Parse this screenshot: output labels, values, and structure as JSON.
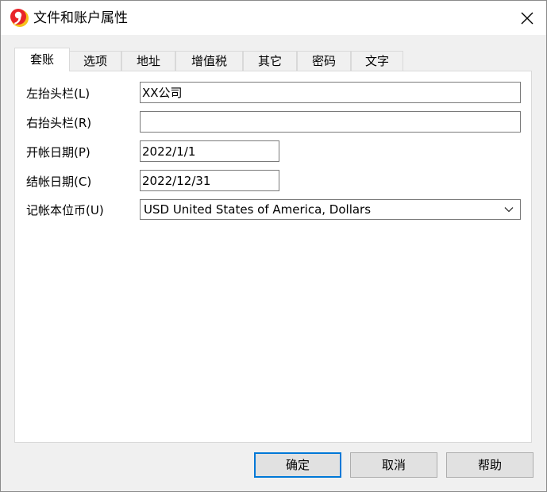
{
  "window": {
    "title": "文件和账户属性"
  },
  "tabs": [
    {
      "label": "套账",
      "active": true
    },
    {
      "label": "选项"
    },
    {
      "label": "地址"
    },
    {
      "label": "增值税"
    },
    {
      "label": "其它"
    },
    {
      "label": "密码"
    },
    {
      "label": "文字"
    }
  ],
  "form": {
    "left_header_label": "左抬头栏(L)",
    "left_header_value": "XX公司",
    "right_header_label": "右抬头栏(R)",
    "right_header_value": "",
    "open_date_label": "开帐日期(P)",
    "open_date_value": "2022/1/1",
    "close_date_label": "结帐日期(C)",
    "close_date_value": "2022/12/31",
    "currency_label": "记帐本位币(U)",
    "currency_value": "USD United States of America, Dollars"
  },
  "buttons": {
    "ok": "确定",
    "cancel": "取消",
    "help": "帮助"
  },
  "colors": {
    "accent": "#0078d7",
    "app_icon_red": "#e8242a",
    "app_icon_yellow": "#f6c21c"
  }
}
